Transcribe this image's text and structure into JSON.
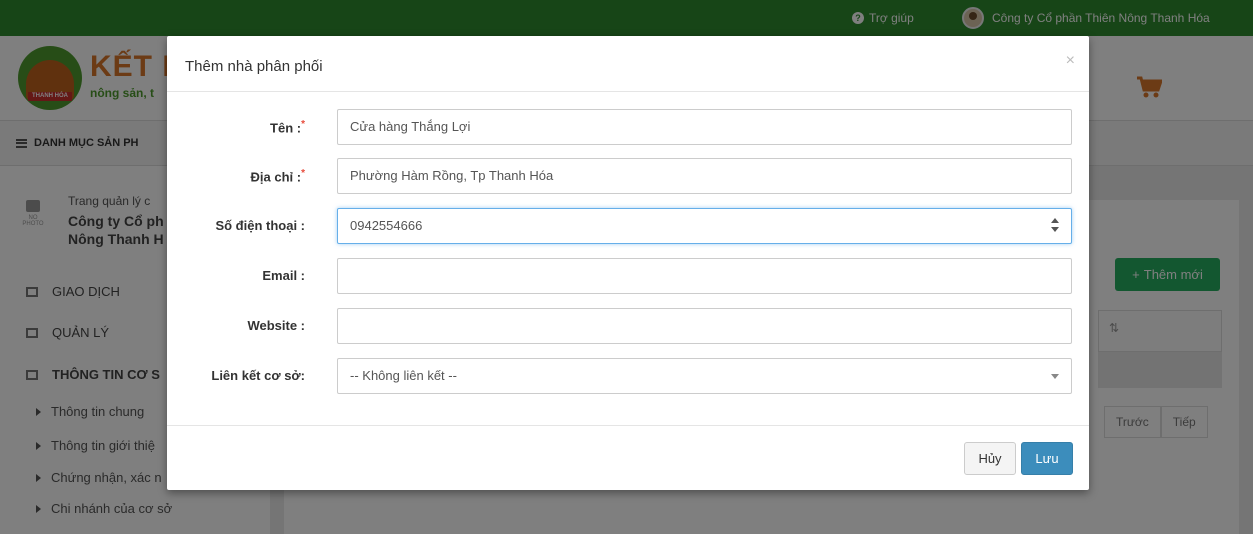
{
  "topbar": {
    "help_label": "Trợ giúp",
    "company_name": "Công ty Cổ phần Thiên Nông Thanh Hóa"
  },
  "header": {
    "brand": "KẾT NỐ",
    "brand_sub": "nông sản, t",
    "logo_tag": "THANH HÓA",
    "accent_color": "#d9772a",
    "green_color": "#2e8b2e"
  },
  "catbar": {
    "label": "DANH MỤC SẢN PH"
  },
  "sidebar": {
    "no_photo": "NO PHOTO",
    "manage_label": "Trang quản lý c",
    "company_line1": "Công ty Cổ ph",
    "company_line2": "Nông Thanh H",
    "menu": [
      {
        "label": "GIAO DỊCH"
      },
      {
        "label": "QUẢN LÝ"
      },
      {
        "label": "THÔNG TIN CƠ S"
      }
    ],
    "sub_items": [
      {
        "label": "Thông tin chung"
      },
      {
        "label": "Thông tin giới thiệ"
      },
      {
        "label": "Chứng nhận, xác n"
      },
      {
        "label": "Chi nhánh của cơ sở"
      }
    ]
  },
  "main": {
    "add_button": "Thêm mới",
    "pager_prev": "Trước",
    "pager_next": "Tiếp"
  },
  "modal": {
    "title": "Thêm nhà phân phối",
    "close": "×",
    "fields": {
      "name": {
        "label": "Tên :",
        "required": "*",
        "value": "Cửa hàng Thắng Lợi"
      },
      "address": {
        "label": "Địa chỉ :",
        "required": "*",
        "value": "Phường Hàm Rồng, Tp Thanh Hóa"
      },
      "phone": {
        "label": "Số điện thoại :",
        "value": "0942554666"
      },
      "email": {
        "label": "Email :",
        "value": ""
      },
      "website": {
        "label": "Website :",
        "value": ""
      },
      "link": {
        "label": "Liên kết cơ sở:",
        "value": "-- Không liên kết --"
      }
    },
    "cancel_label": "Hủy",
    "save_label": "Lưu"
  }
}
